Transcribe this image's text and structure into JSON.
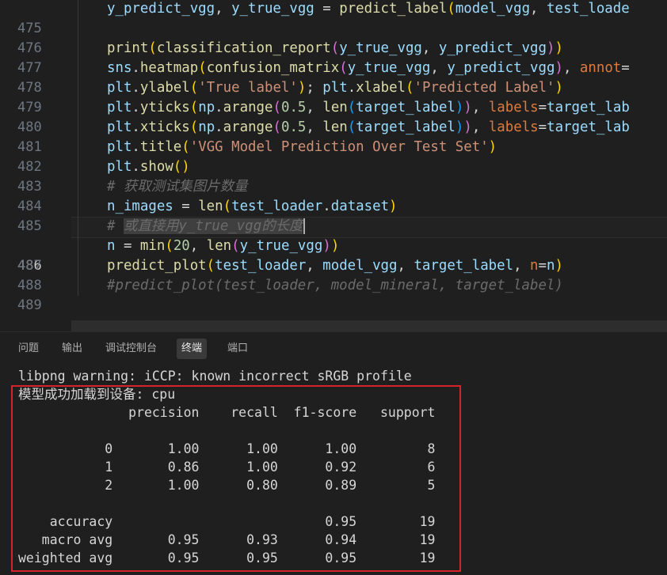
{
  "editor": {
    "lines": [
      {
        "no": "475"
      },
      {
        "no": "476"
      },
      {
        "no": "477"
      },
      {
        "no": "478"
      },
      {
        "no": "479"
      },
      {
        "no": "480"
      },
      {
        "no": "481"
      },
      {
        "no": "482"
      },
      {
        "no": "483"
      },
      {
        "no": "484"
      },
      {
        "no": "485"
      },
      {
        "no": "486"
      },
      {
        "no": "487"
      },
      {
        "no": "488"
      },
      {
        "no": "489"
      }
    ],
    "code": {
      "l475_a": "y_predict_vgg",
      "l475_b": ", ",
      "l475_c": "y_true_vgg",
      "l475_d": " = ",
      "l475_e": "predict_label",
      "l475_f": "(",
      "l475_g": "model_vgg",
      "l475_h": ", ",
      "l475_i": "test_loade",
      "l477_a": "print",
      "l477_b": "(",
      "l477_c": "classification_report",
      "l477_d": "(",
      "l477_e": "y_true_vgg",
      "l477_f": ", ",
      "l477_g": "y_predict_vgg",
      "l477_h": ")",
      "l477_i": ")",
      "l478_a": "sns",
      "l478_b": ".",
      "l478_c": "heatmap",
      "l478_d": "(",
      "l478_e": "confusion_matrix",
      "l478_f": "(",
      "l478_g": "y_true_vgg",
      "l478_h": ", ",
      "l478_i": "y_predict_vgg",
      "l478_j": ")",
      "l478_k": ", ",
      "l478_l": "annot",
      "l478_m": "=",
      "l479_a": "plt",
      "l479_b": ".",
      "l479_c": "ylabel",
      "l479_d": "(",
      "l479_e": "'True label'",
      "l479_f": ")",
      "l479_g": "; ",
      "l479_h": "plt",
      "l479_i": ".",
      "l479_j": "xlabel",
      "l479_k": "(",
      "l479_l": "'Predicted Label'",
      "l479_m": ")",
      "l480_a": "plt",
      "l480_b": ".",
      "l480_c": "yticks",
      "l480_d": "(",
      "l480_e": "np",
      "l480_f": ".",
      "l480_g": "arange",
      "l480_h": "(",
      "l480_i": "0.5",
      "l480_j": ", ",
      "l480_k": "len",
      "l480_l": "(",
      "l480_m": "target_label",
      "l480_n": ")",
      "l480_o": ")",
      "l480_p": ", ",
      "l480_q": "labels",
      "l480_r": "=",
      "l480_s": "target_lab",
      "l481_a": "plt",
      "l481_b": ".",
      "l481_c": "xticks",
      "l481_d": "(",
      "l481_e": "np",
      "l481_f": ".",
      "l481_g": "arange",
      "l481_h": "(",
      "l481_i": "0.5",
      "l481_j": ", ",
      "l481_k": "len",
      "l481_l": "(",
      "l481_m": "target_label",
      "l481_n": ")",
      "l481_o": ")",
      "l481_p": ", ",
      "l481_q": "labels",
      "l481_r": "=",
      "l481_s": "target_lab",
      "l482_a": "plt",
      "l482_b": ".",
      "l482_c": "title",
      "l482_d": "(",
      "l482_e": "'VGG Model Prediction Over Test Set'",
      "l482_f": ")",
      "l483_a": "plt",
      "l483_b": ".",
      "l483_c": "show",
      "l483_d": "()",
      "l484_a": "# 获取测试集图片数量",
      "l485_a": "n_images",
      "l485_b": " = ",
      "l485_c": "len",
      "l485_d": "(",
      "l485_e": "test_loader",
      "l485_f": ".",
      "l485_g": "dataset",
      "l485_h": ")",
      "l486_a": "# ",
      "l486_b": "或直接用y_true_vgg的长度",
      "l487_a": "n",
      "l487_b": " = ",
      "l487_c": "min",
      "l487_d": "(",
      "l487_e": "20",
      "l487_f": ", ",
      "l487_g": "len",
      "l487_h": "(",
      "l487_i": "y_true_vgg",
      "l487_j": ")",
      "l487_k": ")",
      "l488_a": "predict_plot",
      "l488_b": "(",
      "l488_c": "test_loader",
      "l488_d": ", ",
      "l488_e": "model_vgg",
      "l488_f": ", ",
      "l488_g": "target_label",
      "l488_h": ", ",
      "l488_i": "n",
      "l488_j": "=",
      "l488_k": "n",
      "l488_l": ")",
      "l489_a": "#predict_plot(test_loader, model_mineral, target_label)"
    }
  },
  "panel": {
    "tabs": [
      "问题",
      "输出",
      "调试控制台",
      "终端",
      "端口"
    ],
    "active_tab": "终端"
  },
  "terminal": {
    "lines": [
      "libpng warning: iCCP: known incorrect sRGB profile",
      "模型成功加载到设备: cpu",
      "              precision    recall  f1-score   support",
      "",
      "           0       1.00      1.00      1.00         8",
      "           1       0.86      1.00      0.92         6",
      "           2       1.00      0.80      0.89         5",
      "",
      "    accuracy                           0.95        19",
      "   macro avg       0.95      0.93      0.94        19",
      "weighted avg       0.95      0.95      0.95        19"
    ]
  },
  "colors": {
    "highlight_box": "#d4252b",
    "background": "#1f1f1f"
  }
}
